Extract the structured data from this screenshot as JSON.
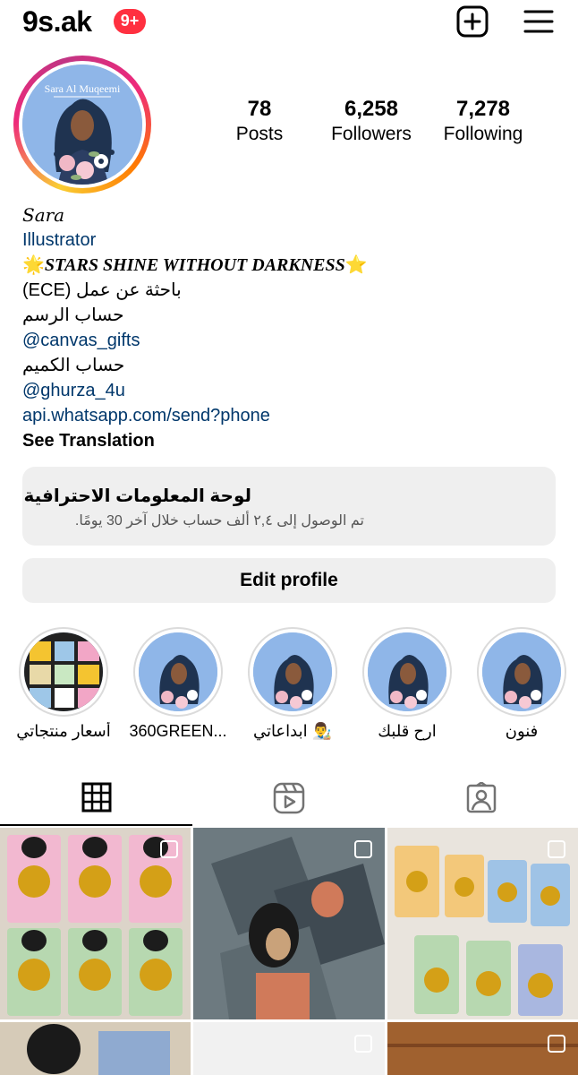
{
  "header": {
    "username": "9s.ak",
    "notification_badge": "9+"
  },
  "profile": {
    "avatar_text": "Sara Al Muqeemi",
    "stats": {
      "posts_count": "78",
      "posts_label": "Posts",
      "followers_count": "6,258",
      "followers_label": "Followers",
      "following_count": "7,278",
      "following_label": "Following"
    },
    "bio": {
      "name": "𝑆𝑎𝑟𝑎",
      "category": "Illustrator",
      "star_left": "🌟",
      "headline": "STARS SHINE WITHOUT DARKNESS",
      "star_right": "⭐",
      "line1": "باحثة عن عمل (ECE)",
      "line2": "حساب الرسم",
      "mention1": "@canvas_gifts",
      "line3": "حساب الكميم",
      "mention2": "@ghurza_4u",
      "link": "api.whatsapp.com/send?phone",
      "see_translation": "See Translation"
    }
  },
  "dashboard": {
    "title": "لوحة المعلومات الاحترافية",
    "subtitle": "تم الوصول إلى ٢,٤ ألف حساب خلال آخر 30 يومًا."
  },
  "edit_profile_label": "Edit profile",
  "highlights": [
    {
      "label": "أسعار منتجاتي"
    },
    {
      "label": "360GREEN..."
    },
    {
      "label": "ابداعاتي 👨‍🎨"
    },
    {
      "label": "ارح قلبك"
    },
    {
      "label": "فنون"
    }
  ],
  "tabs": [
    {
      "icon": "grid-icon",
      "active": true
    },
    {
      "icon": "reels-icon",
      "active": false
    },
    {
      "icon": "tagged-icon",
      "active": false
    }
  ],
  "colors": {
    "link": "#00376b",
    "badge": "#ff3040",
    "panel": "#efefef",
    "avatar_bg": "#8fb6e8"
  }
}
